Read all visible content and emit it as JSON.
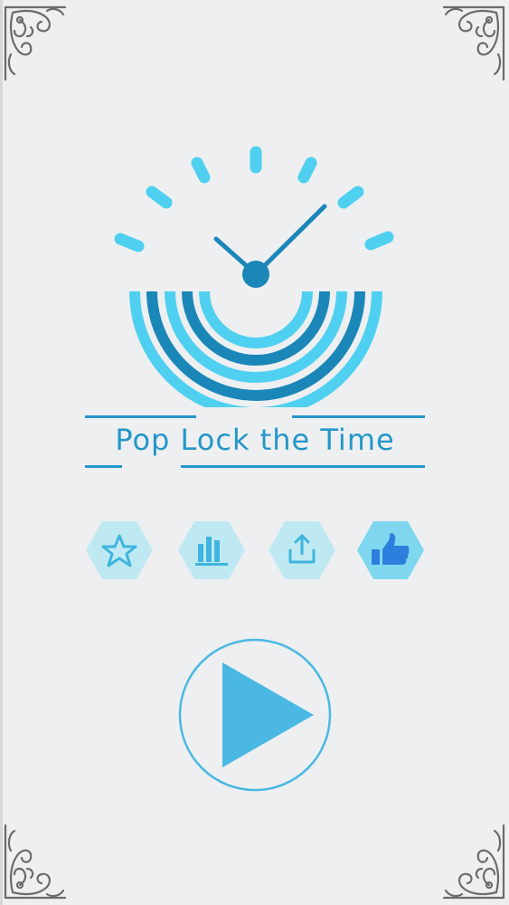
{
  "app": {
    "title": "Pop Lock the Time"
  },
  "buttons": {
    "rate_icon": "star-icon",
    "leaderboard_icon": "bar-chart-icon",
    "share_icon": "share-icon",
    "like_icon": "thumbs-up-icon",
    "play_icon": "play-icon"
  },
  "colors": {
    "background": "#eeeff1",
    "light_blue": "#4fd0f0",
    "dark_blue": "#1a87b8",
    "title_blue": "#2497c8",
    "hex_fill": "#bfe9f2",
    "hex_active_fill": "#7ed7ee",
    "hex_icon": "#3fb4de",
    "like_icon": "#2d7fdd",
    "play_fill": "#4ab8e3"
  }
}
